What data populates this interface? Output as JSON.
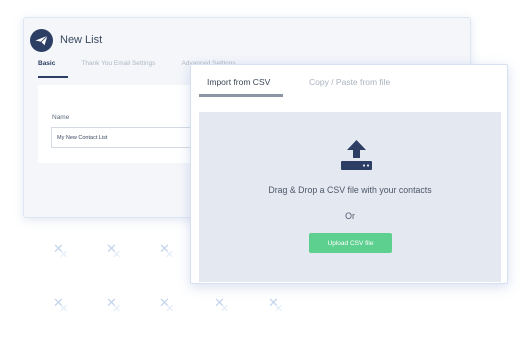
{
  "back_card": {
    "title": "New List",
    "logo_icon": "paper-plane-icon",
    "tabs": [
      {
        "label": "Basic",
        "active": true
      },
      {
        "label": "Thank You Email Settings",
        "active": false
      },
      {
        "label": "Advanced Settings",
        "active": false
      }
    ],
    "name_label": "Name",
    "name_value": "My New Contact List"
  },
  "import_card": {
    "tabs": [
      {
        "label": "Import from CSV",
        "active": true
      },
      {
        "label": "Copy / Paste from file",
        "active": false
      }
    ],
    "upload_icon": "upload-tray-icon",
    "drop_text": "Drag & Drop a CSV file with your contacts",
    "or_text": "Or",
    "upload_button": "Upload CSV file"
  },
  "decoration": {
    "mark_glyph": "✕"
  },
  "colors": {
    "brand_navy": "#2c3e63",
    "upload_green": "#5dcf8f",
    "drop_zone_bg": "#e4e8f1"
  }
}
